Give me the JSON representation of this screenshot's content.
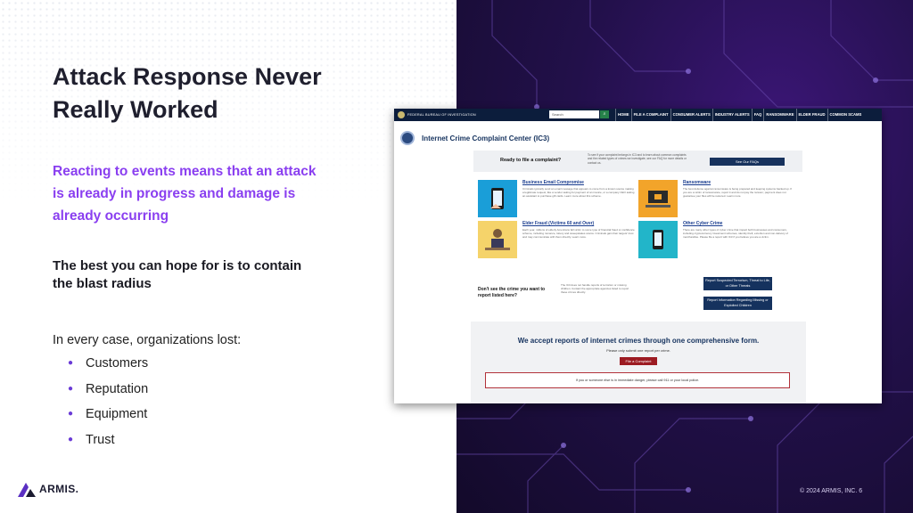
{
  "slide": {
    "title": "Attack Response Never Really Worked",
    "lead": "Reacting to events means that an attack is already in progress and damage is already occurring",
    "point": "The best you can hope for is to contain the blast radius",
    "lost_intro": "In every case, organizations lost:",
    "bullets": [
      "Customers",
      "Reputation",
      "Equipment",
      "Trust"
    ],
    "logo_text": "ARMIS.",
    "copyright": "© 2024 ARMIS, INC.  6"
  },
  "screenshot": {
    "agency_name": "FEDERAL BUREAU OF INVESTIGATION",
    "search_placeholder": "Search",
    "menu": [
      "HOME",
      "FILE A COMPLAINT",
      "CONSUMER ALERTS",
      "INDUSTRY ALERTS",
      "FAQ",
      "RANSOMWARE",
      "ELDER FRAUD",
      "COMMON SCAMS"
    ],
    "page_title": "Internet Crime Complaint Center (IC3)",
    "ready_question": "Ready to file a complaint?",
    "ready_desc": "To see if your complaint belongs in IC3 and to learn about common complaints and the related types of crimes we investigate, see our FAQ for more details or contact us.",
    "faq_button": "See Our FAQs",
    "cards": [
      {
        "title": "Business Email Compromise",
        "body": "Criminals typically send an email message that appears to come from a known source making a legitimate request, like a vendor asking for payment of an invoice, or a company CEO asking an assistant to purchase gift cards. Learn more about this scheme."
      },
      {
        "title": "Ransomware",
        "body": "The best defense against ransomware is being prepared and keeping systems backed up. If you are a victim of ransomware, report it and do not pay the ransom; payment does not guarantee your files will be restored. Learn more."
      },
      {
        "title": "Elder Fraud (Victims 60 and Over)",
        "body": "Each year, millions of elderly Americans fall victim to some type of financial fraud or confidence scheme, including romance, lottery and sweepstakes scams. Criminals gain their targets' trust and may communicate with them directly. Learn more."
      },
      {
        "title": "Other Cyber Crime",
        "body": "There are many other types of cyber crime that impact both businesses and consumers, including cryptocurrency investment schemes, identity theft, extortion and non-delivery of merchandise. Please file a report with IC3 if you believe you are a victim."
      }
    ],
    "dont_see": "Don't see the crime you want to report listed here?",
    "dont_see_desc": "The IC3 does not handle reports of terrorism or missing children. Contact the appropriate agencies listed to report these crimes directly.",
    "btn_terrorism": "Report Suspected Terrorism, Threat to Life, or Other Threats",
    "btn_missing": "Report Information Regarding Missing or Exploited Children",
    "accept_title": "We accept reports of internet crimes through one comprehensive form.",
    "accept_sub": "Please only submit one report per crime.",
    "file_button": "File a Complaint",
    "danger_note": "If you or someone else is in immediate danger, please call 911 or your local police."
  },
  "colors": {
    "accent_purple": "#8a3ff0",
    "panel_dark": "#22104a",
    "fbi_navy": "#0c1d3c",
    "complaint_red": "#9c1b22"
  },
  "icons": {
    "logo": "armis-logo-icon",
    "bullet": "bullet-dot-icon"
  }
}
